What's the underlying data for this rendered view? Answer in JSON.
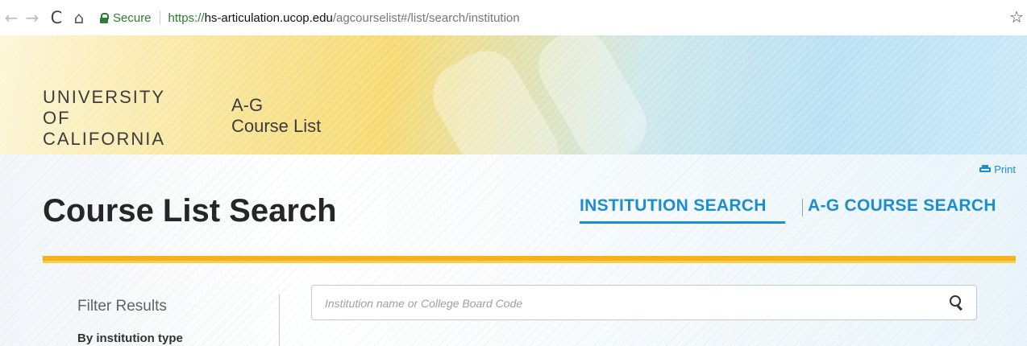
{
  "browser": {
    "secure_label": "Secure",
    "url_scheme": "https://",
    "url_host": "hs-articulation.ucop.edu",
    "url_path": "/agcourselist#/list/search/institution",
    "back_icon": "←",
    "forward_icon": "→",
    "reload_icon": "C",
    "home_icon": "⌂",
    "bookmark_icon": "☆"
  },
  "header": {
    "logo_lines": [
      "UNIVERSITY",
      "OF",
      "CALIFORNIA"
    ],
    "app_title_lines": [
      "A-G",
      "Course List"
    ]
  },
  "page": {
    "print_label": "Print",
    "title": "Course List Search",
    "tabs": [
      {
        "label": "INSTITUTION SEARCH",
        "active": true
      },
      {
        "label": "A-G COURSE SEARCH",
        "active": false
      }
    ]
  },
  "sidebar": {
    "title": "Filter Results",
    "section_label": "By institution type"
  },
  "search": {
    "value": "",
    "placeholder": "Institution name or College Board Code"
  },
  "colors": {
    "accent": "#1a8ecf",
    "gold": "#f6b21a",
    "secure_green": "#2e7d32"
  }
}
